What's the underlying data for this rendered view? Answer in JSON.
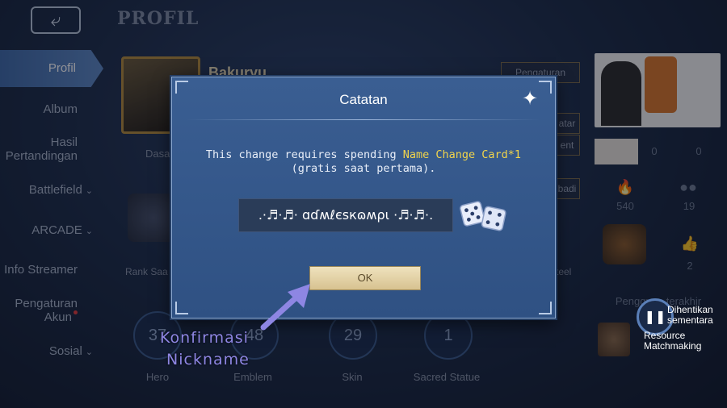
{
  "header": {
    "title": "PROFIL",
    "back_icon": "back-arrow-icon"
  },
  "sidebar": {
    "items": [
      {
        "label": "Profil",
        "active": true
      },
      {
        "label": "Album"
      },
      {
        "label": "Hasil Pertandingan"
      },
      {
        "label": "Battlefield",
        "chevron": true
      },
      {
        "label": "ARCADE",
        "chevron": true
      },
      {
        "label": "Info Streamer"
      },
      {
        "label": "Pengaturan Akun",
        "badge": true
      },
      {
        "label": "Sosial",
        "chevron": true
      }
    ]
  },
  "profile": {
    "name": "Bakuryu",
    "buttons": [
      "Pengaturan",
      "atar",
      "ent",
      "badi"
    ],
    "rank_label": "Rank Saa",
    "steel_label": "teel",
    "dasar_label": "Dasa"
  },
  "stats": [
    {
      "value": "37",
      "label": "Hero"
    },
    {
      "value": "48",
      "label": "Emblem"
    },
    {
      "value": "29",
      "label": "Skin"
    },
    {
      "value": "1",
      "label": "Sacred Statue"
    }
  ],
  "right_panel": {
    "counts": [
      "540",
      "19",
      "2"
    ],
    "used_label": "Pengguna terakhir",
    "zero_values": [
      "0",
      "0"
    ]
  },
  "overlay": {
    "pause_label_line1": "Dihentikan",
    "pause_label_line2": "sementara",
    "resource_line1": "Resource",
    "resource_line2": "Matchmaking"
  },
  "dialog": {
    "title": "Catatan",
    "message_part1": "This change requires spending ",
    "message_highlight": "Name Change Card*1",
    "message_part2": " (gratis saat pertama).",
    "nickname_value": ".·♬·♬· ɑɗʍℓєsкɷʍρι ·♬·♬·.",
    "ok_label": "OK",
    "highlight_color": "#f1d44b"
  },
  "annotation": {
    "line1": "Konfirmasi",
    "line2": "Nickname",
    "color": "#8e86e3"
  }
}
